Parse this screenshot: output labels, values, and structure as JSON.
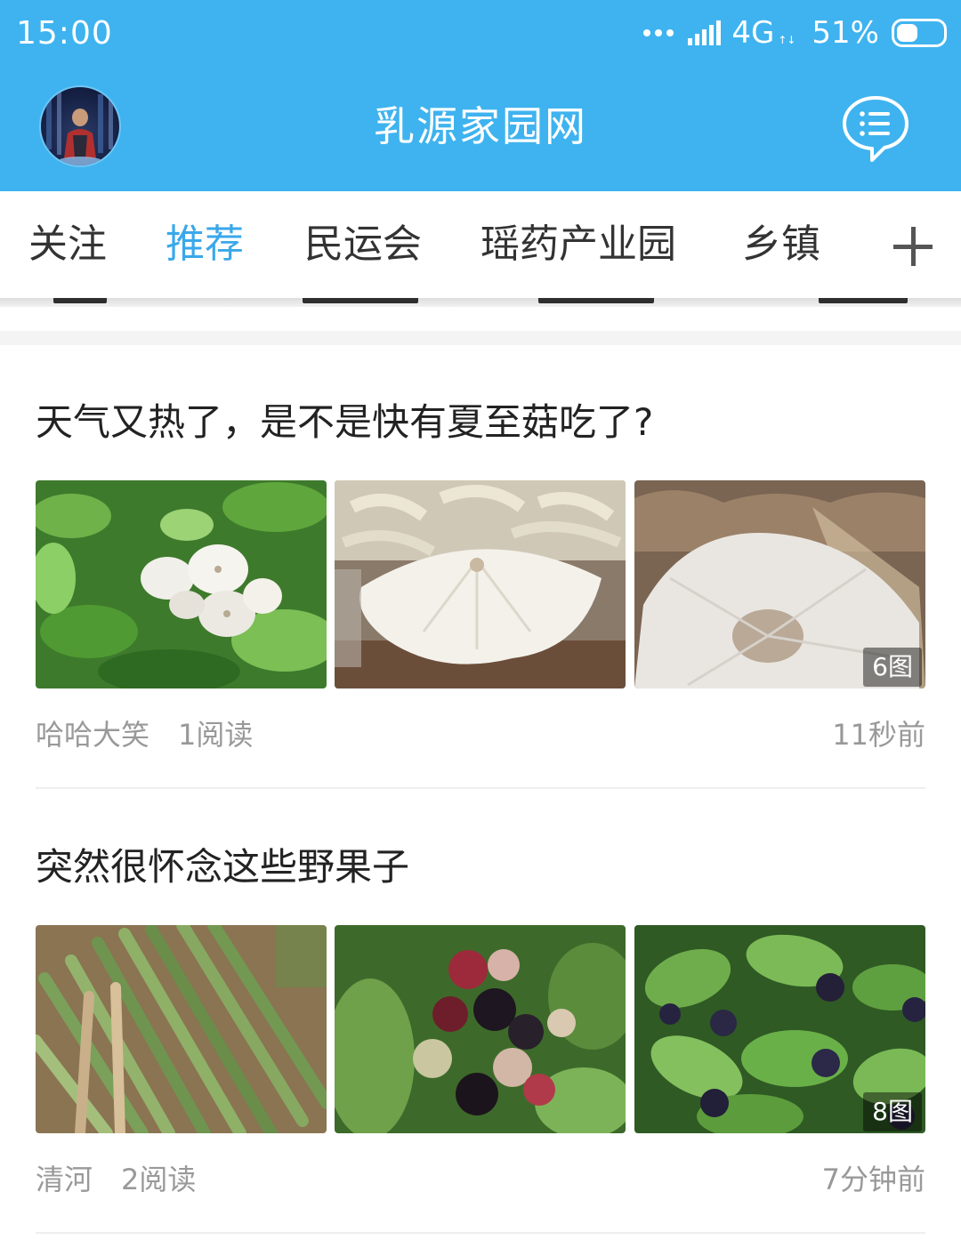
{
  "status_bar": {
    "time": "15:00",
    "network": "4G",
    "battery": "51%",
    "battery_level": 0.51,
    "icons": [
      "more-dots-icon",
      "signal-bars-icon",
      "battery-icon"
    ]
  },
  "app_bar": {
    "title": "乳源家园网",
    "left_icon": "avatar",
    "right_icon": "message-list-icon"
  },
  "tabs": {
    "items": [
      {
        "label": "关注",
        "active": false
      },
      {
        "label": "推荐",
        "active": true
      },
      {
        "label": "民运会",
        "active": false
      },
      {
        "label": "瑶药产业园",
        "active": false
      },
      {
        "label": "乡镇",
        "active": false
      }
    ],
    "add_icon": "plus-icon",
    "active_color": "#3aa8ea",
    "text_color": "#333333"
  },
  "theme": {
    "brand": "#3fb3ef",
    "meta_text": "#999999",
    "title_text": "#222222"
  },
  "posts": [
    {
      "title": "天气又热了，是不是快有夏至菇吃了?",
      "images": [
        "mushrooms-in-grass",
        "mushrooms-in-box",
        "mushroom-closeup"
      ],
      "image_count": "6图",
      "author": "哈哈大笑",
      "reads": "1阅读",
      "time": "11秒前"
    },
    {
      "title": "突然很怀念这些野果子",
      "images": [
        "bamboo-shoots",
        "red-black-wild-berries",
        "blue-berries-on-leaves"
      ],
      "image_count": "8图",
      "author": "清河",
      "reads": "2阅读",
      "time": "7分钟前"
    }
  ]
}
